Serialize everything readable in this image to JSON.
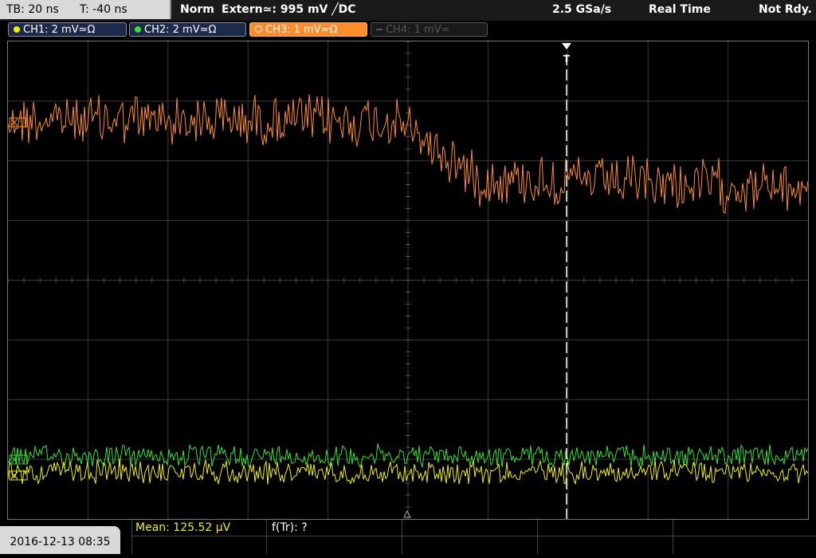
{
  "header": {
    "timebase": "TB: 20 ns",
    "trigger_time": "T: -40 ns",
    "trigger_mode": "Norm",
    "trigger_source": "Extern≃: 995 mV ╱DC",
    "sample_rate": "2.5 GSa/s",
    "acq_mode": "Real Time",
    "status": "Not Rdy."
  },
  "channels": [
    {
      "label": "CH1: 2 mV≃Ω",
      "color": "#f0f000",
      "active": true
    },
    {
      "label": "CH2: 2 mV≃Ω",
      "color": "#33e033",
      "active": true
    },
    {
      "label": "CH3: 1 mV≃Ω",
      "color": "#ff8c2a",
      "active": true
    },
    {
      "label": "CH4: 1 mV≃",
      "color": "#555555",
      "active": false
    }
  ],
  "markers": {
    "trigger_label": "T"
  },
  "footer": {
    "datetime": "2016-12-13 08:35",
    "mean": "Mean: 125.52 µV",
    "ftr": "f(Tr): ?"
  },
  "colors": {
    "grid": "#3a3a3a",
    "ch1": "#f0f000",
    "ch2": "#33e033",
    "ch3": "#ff8c2a",
    "trigger": "#ffffff",
    "mean_text": "#f0f000"
  }
}
